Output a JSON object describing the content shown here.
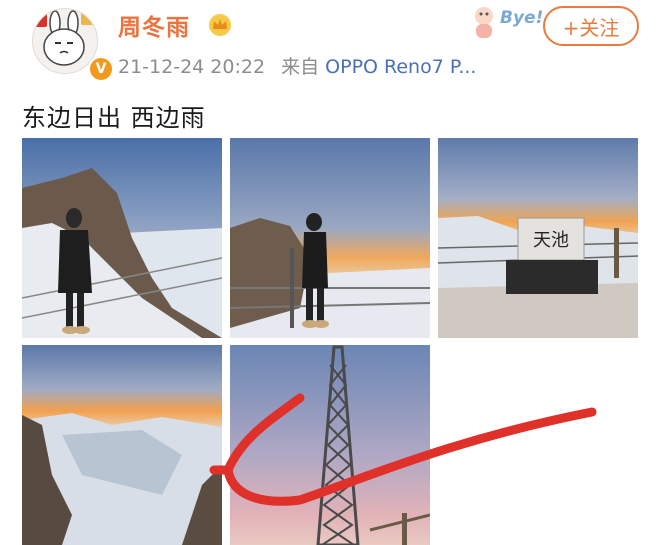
{
  "post": {
    "author": {
      "name": "周冬雨",
      "verified_badge": "V",
      "avatar_icon": "cartoon-rabbit-avatar",
      "crown_icon": "crown-icon"
    },
    "timestamp": "21-12-24 20:22",
    "source_prefix": "来自",
    "source_device": "OPPO Reno7 P...",
    "follow_label": "+关注",
    "sticker_text": "Bye!",
    "text": "东边日出 西边雨",
    "photos": [
      {
        "name": "photo-woman-cliff-sunset"
      },
      {
        "name": "photo-woman-railing-sunset"
      },
      {
        "name": "photo-tianchi-stone-marker",
        "marker_text": "天池"
      },
      {
        "name": "photo-snowy-valley-sunset"
      },
      {
        "name": "photo-steel-tower-dusk"
      }
    ]
  },
  "annotation": {
    "type": "red-arrow-pointing-left",
    "color": "#e0302a"
  },
  "colors": {
    "username": "#eb7340",
    "follow": "#ea7a3e",
    "source_link": "#4a6fb5",
    "meta": "#8c8c8c"
  }
}
